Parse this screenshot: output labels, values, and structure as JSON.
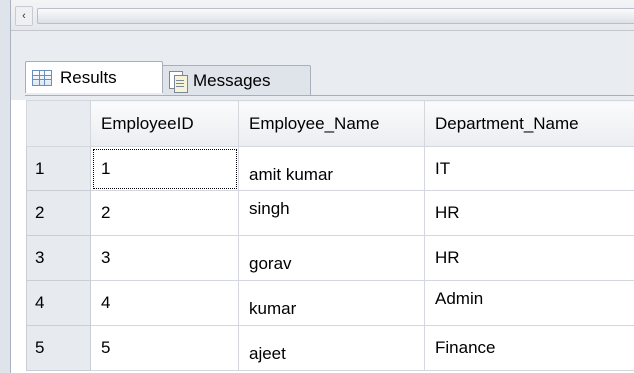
{
  "scrollbar": {
    "left_arrow": "‹"
  },
  "tabs": [
    {
      "label": "Results",
      "icon": "grid-icon",
      "active": true
    },
    {
      "label": "Messages",
      "icon": "messages-icon",
      "active": false
    }
  ],
  "results": {
    "columns": [
      "EmployeeID",
      "Employee_Name",
      "Department_Name"
    ],
    "rows": [
      {
        "rownum": "1",
        "EmployeeID": "1",
        "Employee_Name": "amit kumar",
        "Department_Name": "IT"
      },
      {
        "rownum": "2",
        "EmployeeID": "2",
        "Employee_Name": "singh",
        "Department_Name": "HR"
      },
      {
        "rownum": "3",
        "EmployeeID": "3",
        "Employee_Name": "gorav",
        "Department_Name": "HR"
      },
      {
        "rownum": "4",
        "EmployeeID": "4",
        "Employee_Name": "kumar",
        "Department_Name": "Admin"
      },
      {
        "rownum": "5",
        "EmployeeID": "5",
        "Employee_Name": "ajeet",
        "Department_Name": "Finance"
      }
    ]
  },
  "colors": {
    "tab_border": "#a7afbb",
    "header_bg": "#ebedf1",
    "rownum_bg": "#e7eaef"
  }
}
